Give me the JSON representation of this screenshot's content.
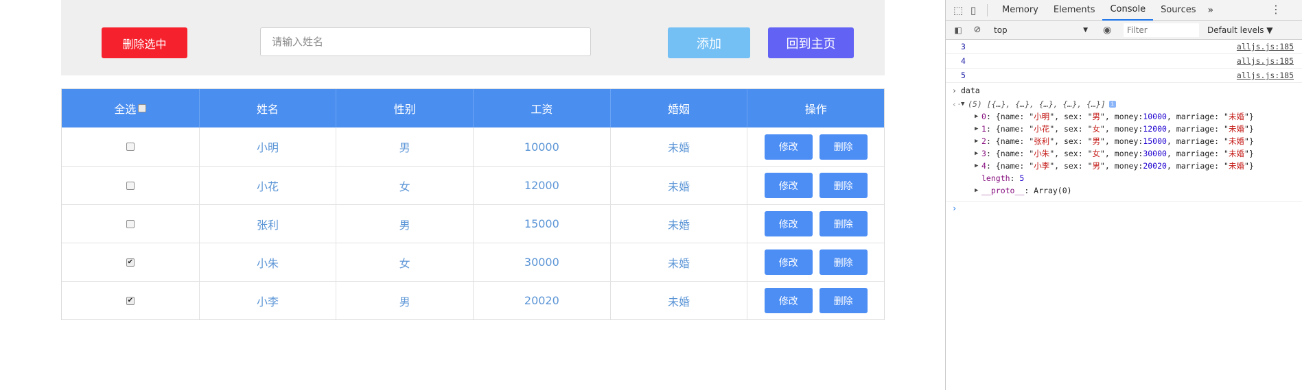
{
  "toolbar": {
    "delete_selected_label": "删除选中",
    "name_placeholder": "请输入姓名",
    "name_value": "",
    "add_label": "添加",
    "home_label": "回到主页"
  },
  "table": {
    "headers": [
      "全选",
      "姓名",
      "性别",
      "工资",
      "婚姻",
      "操作"
    ],
    "edit_label": "修改",
    "delete_label": "删除",
    "rows": [
      {
        "checked": false,
        "name": "小明",
        "sex": "男",
        "money": "10000",
        "marriage": "未婚"
      },
      {
        "checked": false,
        "name": "小花",
        "sex": "女",
        "money": "12000",
        "marriage": "未婚"
      },
      {
        "checked": false,
        "name": "张利",
        "sex": "男",
        "money": "15000",
        "marriage": "未婚"
      },
      {
        "checked": true,
        "name": "小朱",
        "sex": "女",
        "money": "30000",
        "marriage": "未婚"
      },
      {
        "checked": true,
        "name": "小李",
        "sex": "男",
        "money": "20020",
        "marriage": "未婚"
      }
    ]
  },
  "devtools": {
    "tabs": [
      "Memory",
      "Elements",
      "Console",
      "Sources"
    ],
    "more_tabs": "»",
    "active_tab": "Console",
    "context": "top",
    "filter_placeholder": "Filter",
    "levels": "Default levels ▼",
    "console": {
      "logs": [
        {
          "value": "3",
          "source": "alljs.js:185"
        },
        {
          "value": "4",
          "source": "alljs.js:185"
        },
        {
          "value": "5",
          "source": "alljs.js:185"
        }
      ],
      "input": "data",
      "summary": "(5) [{…}, {…}, {…}, {…}, {…}]",
      "items": [
        {
          "idx": "0",
          "name": "小明",
          "sex": "男",
          "money": "10000",
          "marriage": "未婚"
        },
        {
          "idx": "1",
          "name": "小花",
          "sex": "女",
          "money": "12000",
          "marriage": "未婚"
        },
        {
          "idx": "2",
          "name": "张利",
          "sex": "男",
          "money": "15000",
          "marriage": "未婚"
        },
        {
          "idx": "3",
          "name": "小朱",
          "sex": "女",
          "money": "30000",
          "marriage": "未婚"
        },
        {
          "idx": "4",
          "name": "小李",
          "sex": "男",
          "money": "20020",
          "marriage": "未婚"
        }
      ],
      "length_key": "length",
      "length_value": "5",
      "proto_key": "__proto__",
      "proto_value": "Array(0)"
    }
  }
}
